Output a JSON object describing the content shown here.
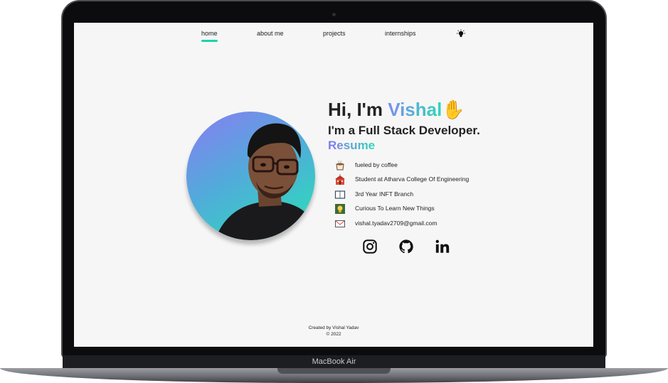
{
  "device": {
    "brand_label": "MacBook Air"
  },
  "nav": {
    "items": [
      {
        "label": "home",
        "active": true
      },
      {
        "label": "about me",
        "active": false
      },
      {
        "label": "projects",
        "active": false
      },
      {
        "label": "internships",
        "active": false
      }
    ],
    "theme_toggle_icon": "lightbulb-icon"
  },
  "hero": {
    "greeting": "Hi, I'm ",
    "name": "Vishal",
    "wave_emoji": "✋",
    "subtitle": "I'm a Full Stack Developer.",
    "resume_label": "Resume"
  },
  "facts": [
    {
      "icon": "coffee-icon",
      "text": "fueled by coffee"
    },
    {
      "icon": "school-icon",
      "text": "Student at Atharva College Of Engineering"
    },
    {
      "icon": "book-icon",
      "text": "3rd Year INFT Branch"
    },
    {
      "icon": "idea-icon",
      "text": "Curious To Learn New Things"
    },
    {
      "icon": "mail-icon",
      "text": "vishal.tyadav2709@gmail.com"
    }
  ],
  "social": [
    {
      "icon": "instagram-icon"
    },
    {
      "icon": "github-icon"
    },
    {
      "icon": "linkedin-icon"
    }
  ],
  "footer": {
    "created_by": "Created by Vishal Yadav",
    "copyright": "© 2022"
  },
  "colors": {
    "accent_teal": "#19d4b0",
    "accent_purple": "#8a7cf3",
    "text": "#222222",
    "screen_bg": "#f6f6f6"
  }
}
